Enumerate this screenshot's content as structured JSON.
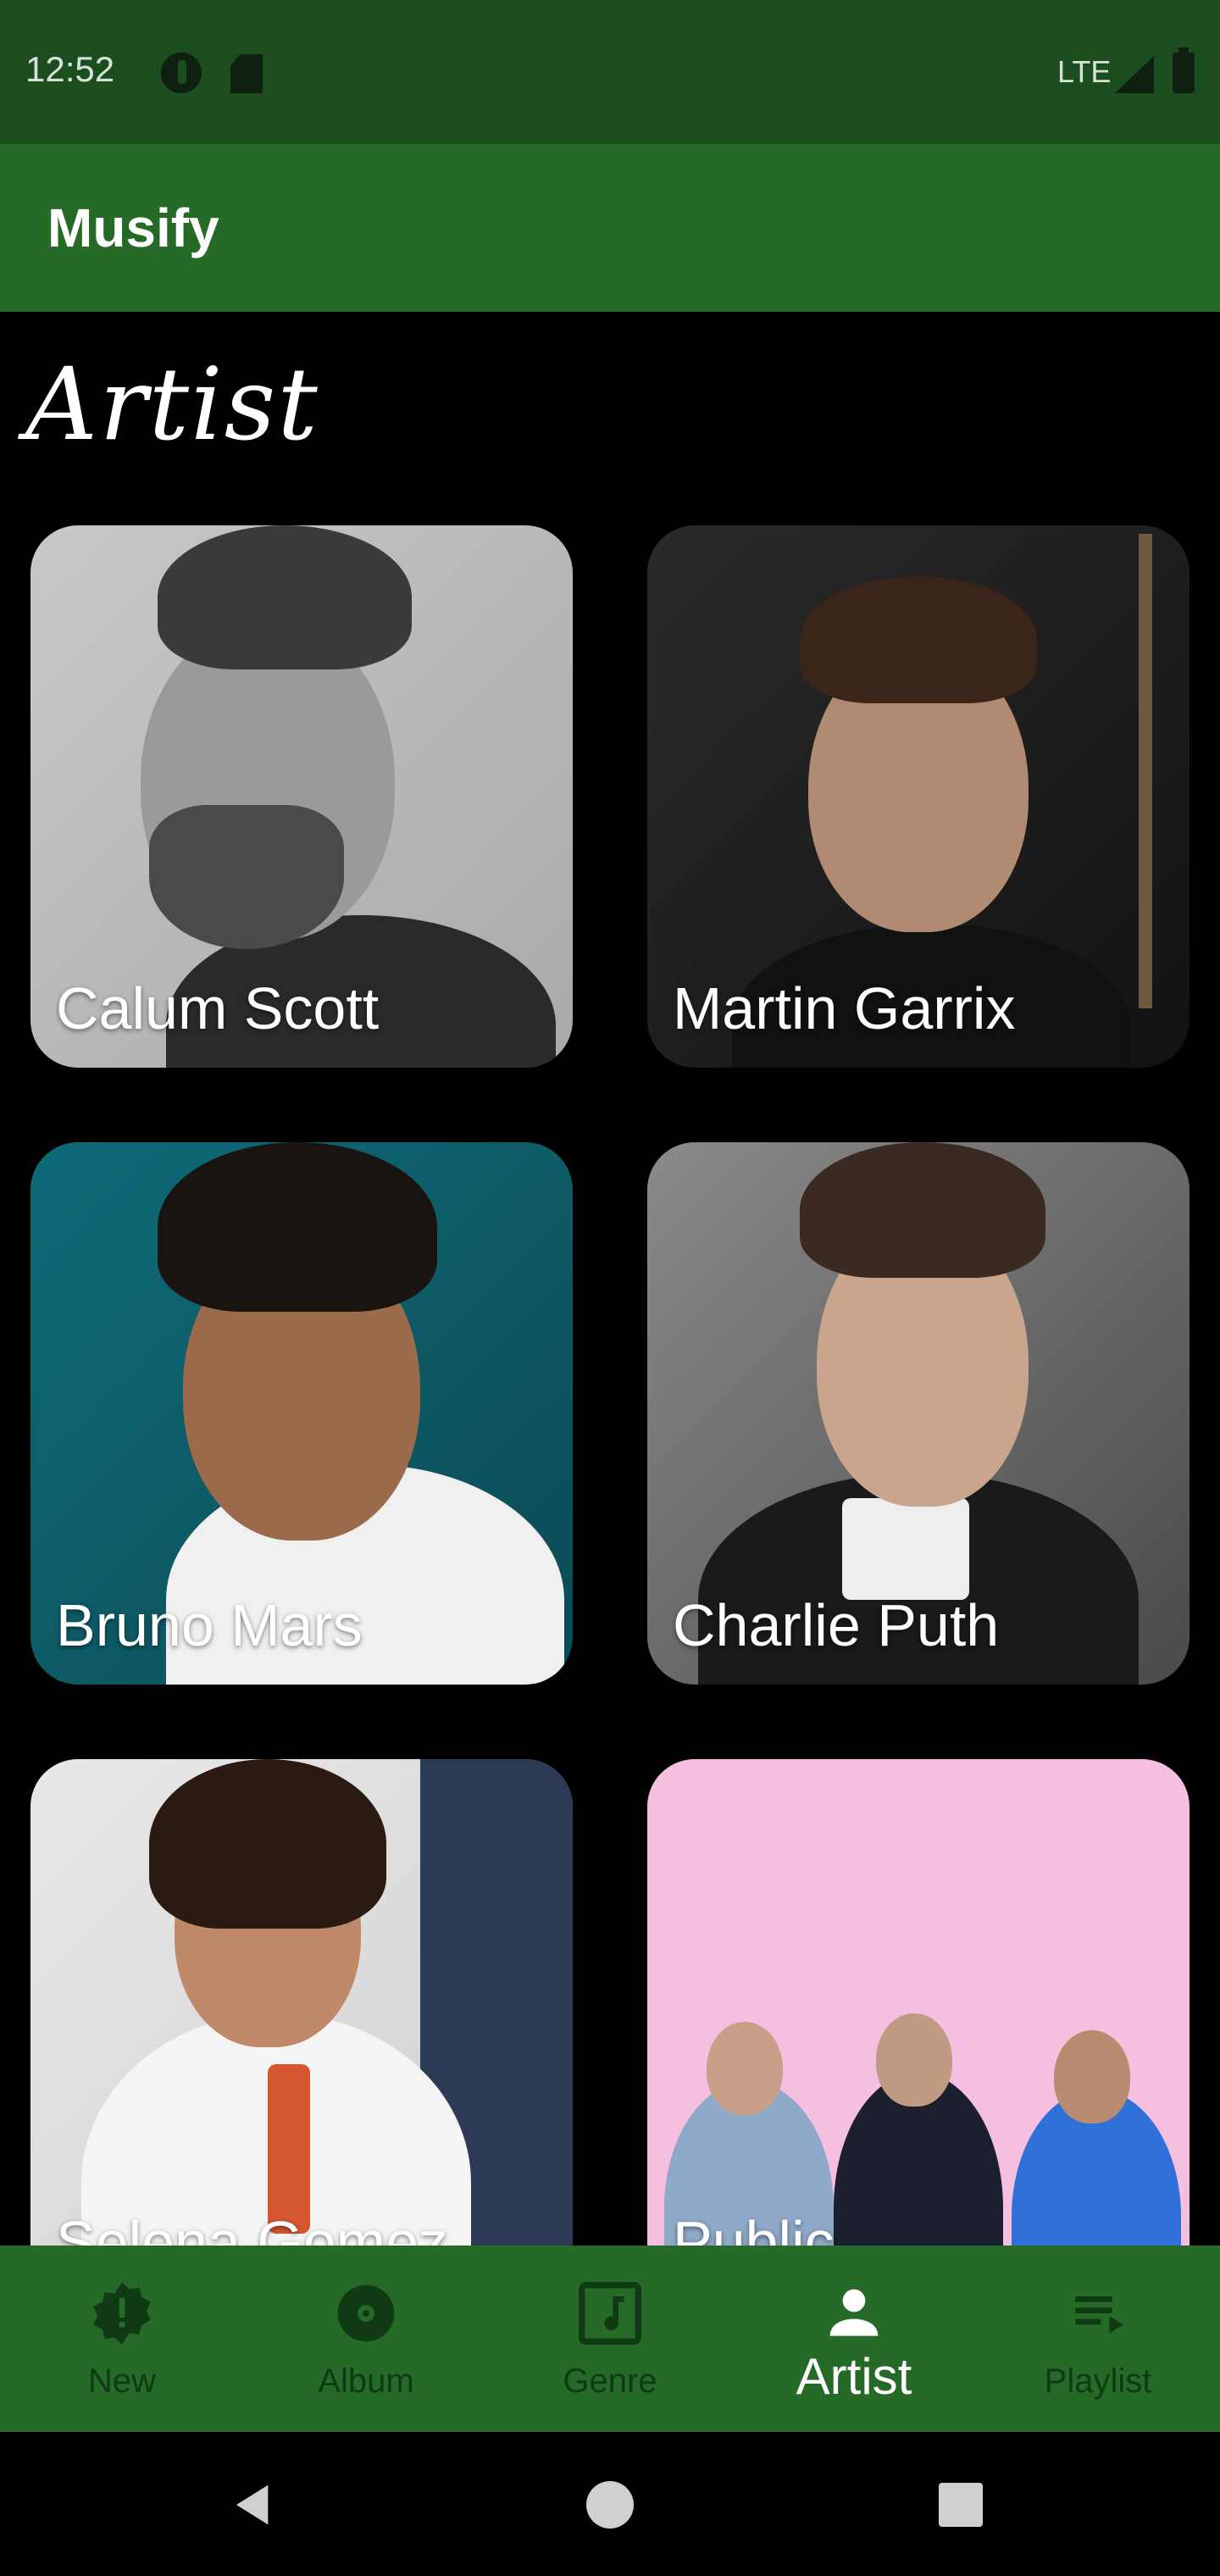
{
  "status_bar": {
    "time": "12:52",
    "network": "LTE"
  },
  "app_bar": {
    "title": "Musify"
  },
  "page": {
    "section_title": "Artist"
  },
  "artists": [
    {
      "name": "Calum Scott"
    },
    {
      "name": "Martin Garrix"
    },
    {
      "name": "Bruno Mars"
    },
    {
      "name": "Charlie Puth"
    },
    {
      "name": "Selena Gomez"
    },
    {
      "name": "Public"
    }
  ],
  "bottom_nav": {
    "items": [
      {
        "label": "New",
        "icon": "new-badge-icon"
      },
      {
        "label": "Album",
        "icon": "disc-icon"
      },
      {
        "label": "Genre",
        "icon": "music-note-icon"
      },
      {
        "label": "Artist",
        "icon": "person-icon"
      },
      {
        "label": "Playlist",
        "icon": "playlist-icon"
      }
    ],
    "active": "Artist"
  },
  "colors": {
    "status_bar": "#1b4d1f",
    "app_bar": "#256a26",
    "background": "#000000",
    "nav_inactive": "#103a14",
    "nav_active": "#ffffff"
  }
}
